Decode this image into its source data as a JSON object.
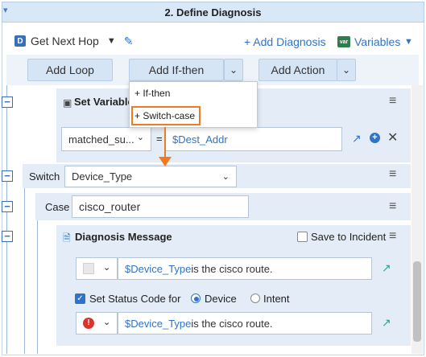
{
  "panel": {
    "title": "2. Define Diagnosis",
    "collapse_arrow": "▾"
  },
  "header": {
    "badge": "D",
    "hop_title": "Get Next Hop",
    "add_diagnosis": "+ Add Diagnosis",
    "variables_badge": "var",
    "variables": "Variables"
  },
  "toolbar": {
    "add_loop": "Add Loop",
    "add_if_then": "Add If-then",
    "add_action": "Add Action"
  },
  "menu": {
    "items": [
      "+ If-then",
      "+ Switch-case"
    ],
    "highlight_color": "#f07a22"
  },
  "set_variable": {
    "label": "Set Variable",
    "select_value": "matched_su...",
    "equals": "=",
    "expr": "$Dest_Addr"
  },
  "switch_row": {
    "label": "Switch",
    "select_value": "Device_Type"
  },
  "case_row": {
    "label": "Case",
    "value": "cisco_router"
  },
  "diag_message": {
    "title": "Diagnosis Message",
    "save_to_incident": "Save to Incident",
    "msg1_var": "$Device_Type",
    "msg1_text": " is the cisco route.",
    "set_status_label": "Set Status Code for",
    "opt_device": "Device",
    "opt_intent": "Intent",
    "msg2_var": "$Device_Type",
    "msg2_text": " is the cisco route."
  },
  "colors": {
    "accent": "#2f74c9",
    "header_bg": "#d9e8f6",
    "row_bg": "#e4edf7",
    "orange": "#f07a22",
    "error_red": "#d9342b",
    "teal": "#27a59a"
  }
}
